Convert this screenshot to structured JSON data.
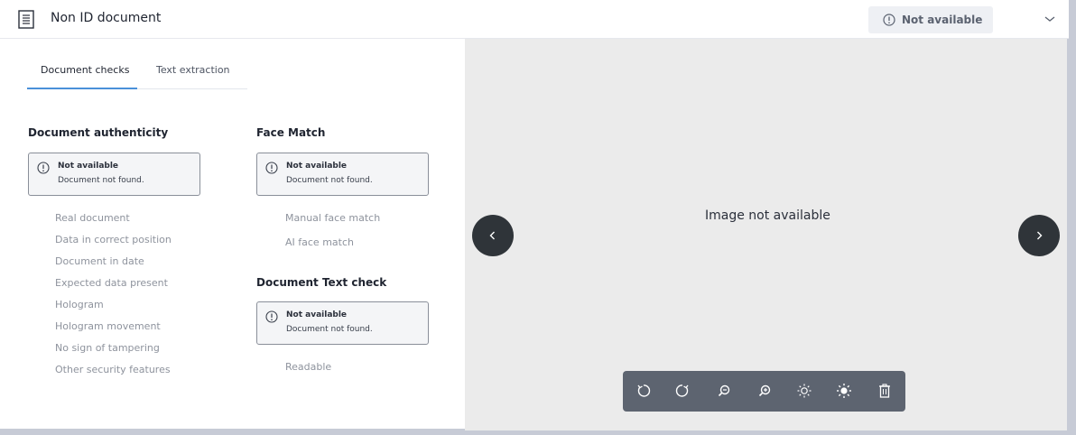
{
  "header": {
    "title": "Non ID document",
    "status_label": "Not available",
    "icons": {
      "document": "document-icon",
      "status": "info-icon",
      "expand": "chevron-down-icon"
    }
  },
  "tabs": [
    {
      "label": "Document checks",
      "active": true
    },
    {
      "label": "Text extraction",
      "active": false
    }
  ],
  "sections": {
    "authenticity": {
      "title": "Document authenticity",
      "notice": {
        "title": "Not available",
        "message": "Document not found."
      },
      "items": [
        "Real document",
        "Data in correct position",
        "Document in date",
        "Expected data present",
        "Hologram",
        "Hologram movement",
        "No sign of tampering",
        "Other security features"
      ]
    },
    "face_match": {
      "title": "Face Match",
      "notice": {
        "title": "Not available",
        "message": "Document not found."
      },
      "items": [
        "Manual face match",
        "AI face match"
      ]
    },
    "text_check": {
      "title": "Document Text check",
      "notice": {
        "title": "Not available",
        "message": "Document not found."
      },
      "items": [
        "Readable"
      ]
    }
  },
  "viewer": {
    "message": "Image not available",
    "toolbar": [
      "rotate-left-icon",
      "rotate-right-icon",
      "zoom-out-icon",
      "zoom-in-icon",
      "brightness-down-icon",
      "brightness-up-icon",
      "delete-icon"
    ]
  },
  "colors": {
    "tab_accent": "#4a90d9",
    "viewer_bg": "#ebebeb",
    "toolbar_bg": "#5d6470",
    "nav_button": "#2f3439",
    "muted_text": "#8e939d"
  }
}
